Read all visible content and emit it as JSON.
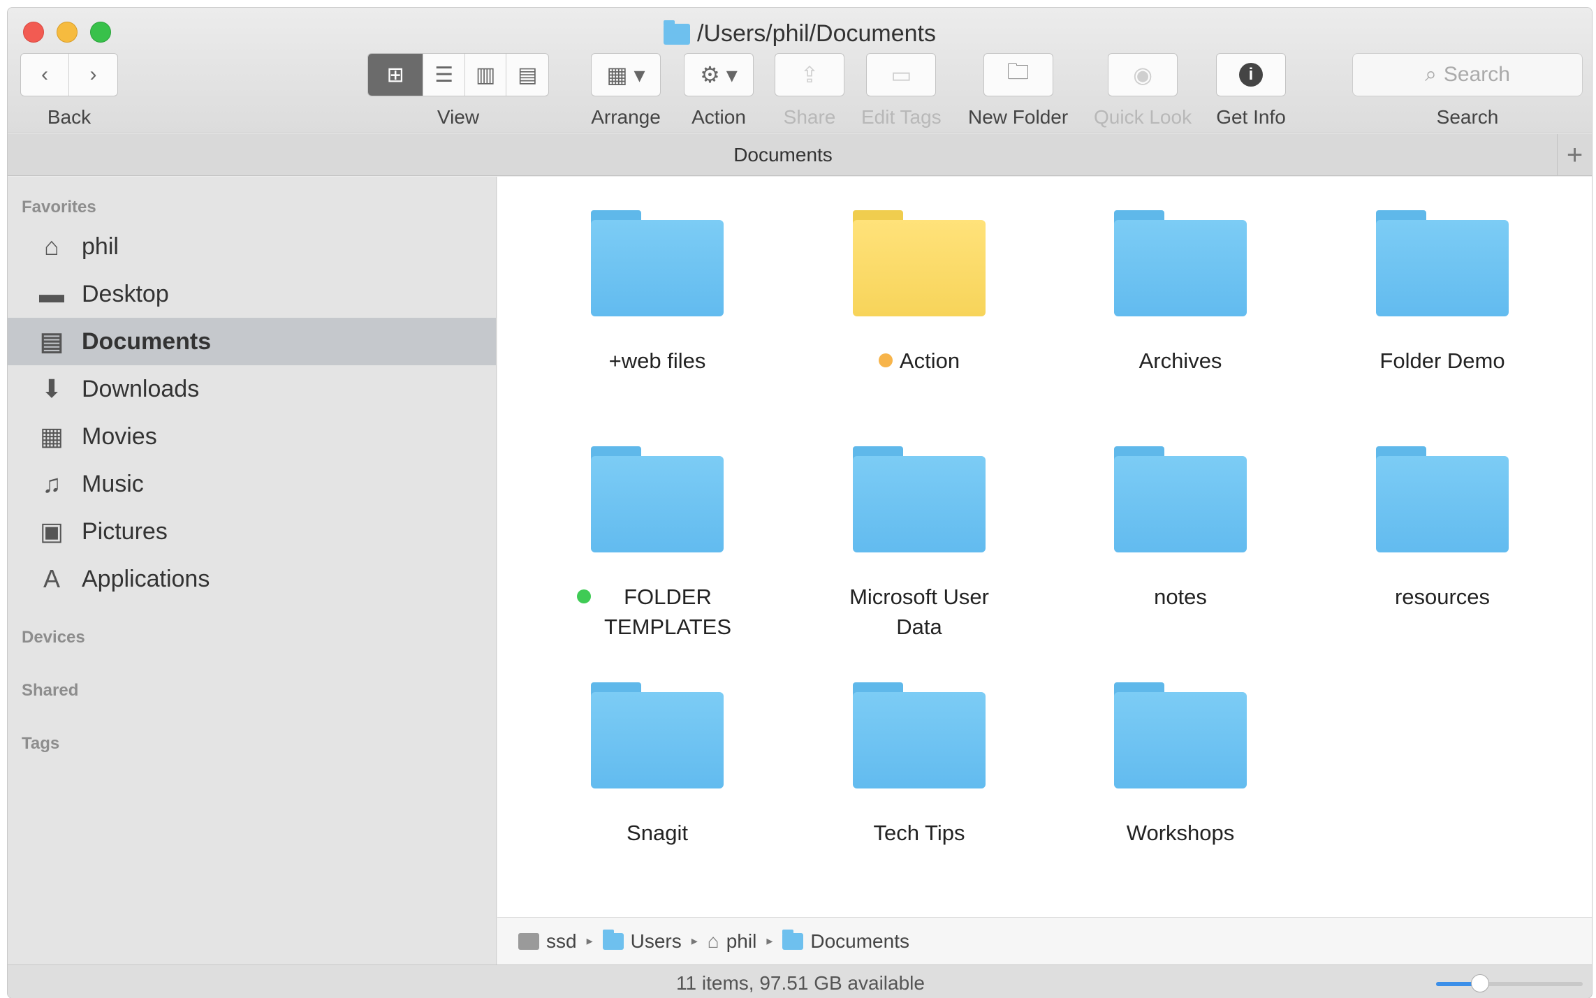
{
  "window": {
    "title": "/Users/phil/Documents"
  },
  "toolbar": {
    "back_label": "Back",
    "view_label": "View",
    "arrange_label": "Arrange",
    "action_label": "Action",
    "share_label": "Share",
    "edit_tags_label": "Edit Tags",
    "new_folder_label": "New Folder",
    "quick_look_label": "Quick Look",
    "get_info_label": "Get Info",
    "search_label": "Search",
    "search_placeholder": "Search"
  },
  "tab": {
    "title": "Documents",
    "add": "+"
  },
  "sidebar": {
    "favorites_header": "Favorites",
    "items": [
      {
        "label": "phil",
        "icon": "home-icon"
      },
      {
        "label": "Desktop",
        "icon": "desktop-icon"
      },
      {
        "label": "Documents",
        "icon": "documents-icon",
        "selected": true
      },
      {
        "label": "Downloads",
        "icon": "downloads-icon"
      },
      {
        "label": "Movies",
        "icon": "movies-icon"
      },
      {
        "label": "Music",
        "icon": "music-icon"
      },
      {
        "label": "Pictures",
        "icon": "pictures-icon"
      },
      {
        "label": "Applications",
        "icon": "applications-icon"
      }
    ],
    "devices_header": "Devices",
    "shared_header": "Shared",
    "tags_header": "Tags"
  },
  "files": [
    {
      "name": "+web files",
      "color": "#6ec0ee"
    },
    {
      "name": "Action",
      "color": "#f7d45a",
      "tag": "orange"
    },
    {
      "name": "Archives",
      "color": "#6ec0ee"
    },
    {
      "name": "Folder Demo",
      "color": "#6ec0ee"
    },
    {
      "name": "FOLDER TEMPLATES",
      "color": "#6ec0ee",
      "tag": "green"
    },
    {
      "name": "Microsoft User Data",
      "color": "#6ec0ee"
    },
    {
      "name": "notes",
      "color": "#6ec0ee"
    },
    {
      "name": "resources",
      "color": "#6ec0ee"
    },
    {
      "name": "Snagit",
      "color": "#6ec0ee"
    },
    {
      "name": "Tech Tips",
      "color": "#6ec0ee"
    },
    {
      "name": "Workshops",
      "color": "#6ec0ee"
    }
  ],
  "pathbar": {
    "crumbs": [
      "ssd",
      "Users",
      "phil",
      "Documents"
    ]
  },
  "status": {
    "text": "11 items, 97.51 GB available",
    "icon_size_level": 0.3
  }
}
